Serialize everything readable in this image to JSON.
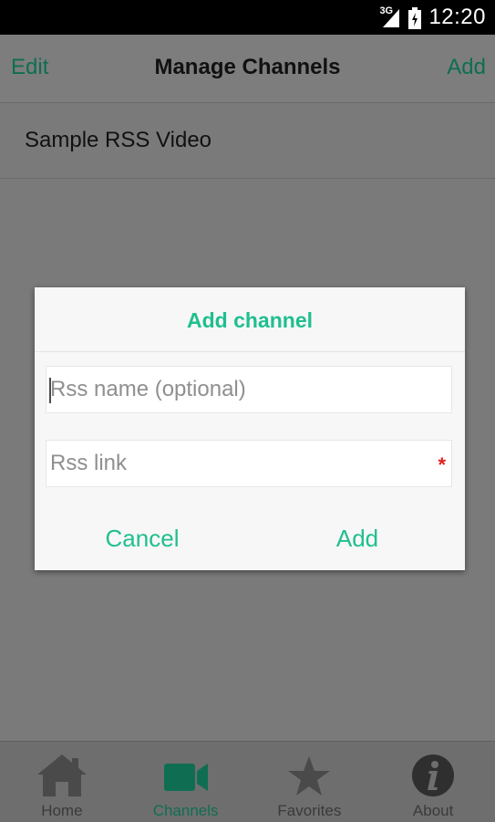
{
  "status_bar": {
    "network_type": "3G",
    "time": "12:20"
  },
  "app_bar": {
    "edit_label": "Edit",
    "title": "Manage Channels",
    "add_label": "Add"
  },
  "channels": [
    {
      "name": "Sample RSS Video"
    }
  ],
  "dialog": {
    "title": "Add channel",
    "name_placeholder": "Rss name (optional)",
    "link_placeholder": "Rss link",
    "required_marker": "*",
    "cancel_label": "Cancel",
    "add_label": "Add"
  },
  "tabs": [
    {
      "label": "Home",
      "icon": "home-icon"
    },
    {
      "label": "Channels",
      "icon": "video-camera-icon",
      "active": true
    },
    {
      "label": "Favorites",
      "icon": "star-icon"
    },
    {
      "label": "About",
      "icon": "info-icon"
    }
  ],
  "colors": {
    "accent": "#1fbf8f",
    "accent_dimmed": "#0f6e52",
    "required": "#e02020"
  }
}
